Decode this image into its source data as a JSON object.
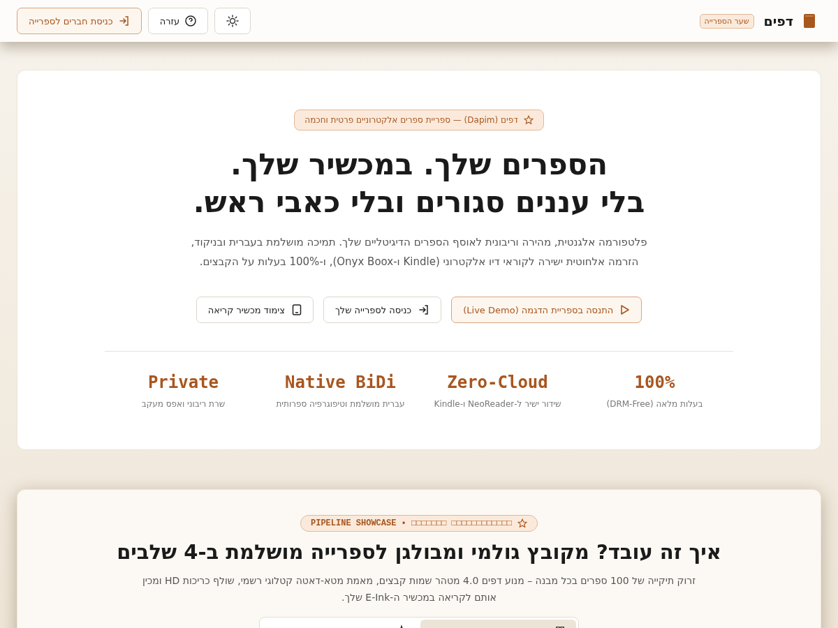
{
  "header": {
    "brand": "דפים",
    "brand_badge": "שער הספרייה",
    "buttons": [
      {
        "kind": "theme"
      },
      {
        "kind": "help",
        "label": "עזרה"
      },
      {
        "kind": "login",
        "label": "כניסת חברים לספרייה"
      }
    ]
  },
  "hero": {
    "badge": "דפים (Dapim) — ספריית ספרים אלקטרוניים פרטית וחכמה",
    "title_lines": [
      "הספרים שלך. במכשיר שלך.",
      "בלי עננים סגורים ובלי כאבי ראש."
    ],
    "subtitle_lines": [
      "פלטפורמה אלגנטית, מהירה וריבונית לאוסף הספרים הדיגיטליים שלך. תמיכה מושלמת בעברית ובניקוד,",
      "הזרמה אלחוטית ישירה לקוראי דיו אלקטרוני (Kindle ו-Onyx Boox), ו-100% בעלות על הקבצים."
    ],
    "actions": [
      {
        "kind": "demo",
        "label": "התנסה בספריית הדגמה (Live Demo)"
      },
      {
        "kind": "enter",
        "label": "כניסה לספרייה שלך"
      },
      {
        "kind": "device",
        "label": "צימוד מכשיר קריאה"
      }
    ],
    "stats": [
      {
        "value": "100%",
        "caption": "בעלות מלאה (DRM-Free)"
      },
      {
        "value": "Zero-Cloud",
        "caption": "שידור ישיר ל-NeoReader ו-Kindle"
      },
      {
        "value": "Native BiDi",
        "caption": "עברית מושלמת וטיפוגרפיה ספרותית"
      },
      {
        "value": "Private",
        "caption": "שרת ריבוני ואפס מעקב"
      }
    ]
  },
  "pipeline": {
    "badge": "PIPELINE SHOWCASE • □□□□□□□ □□□□□□□□□□□□",
    "title": "איך זה עובד? מקובץ גולמי ומבולגן לספרייה מושלמת ב-4 שלבים",
    "description": "זרוק תיקייה של 100 ספרים בכל מבנה – מנוע דפים 4.0 מטהר שמות קבצים, מאמת מטא-דאטה קטלוגי רשמי, שולף כריכות HD ומכין אותם לקריאה במכשיר ה-E-Ink שלך.",
    "tabs": [
      {
        "selected": true
      },
      {
        "selected": false
      }
    ]
  }
}
